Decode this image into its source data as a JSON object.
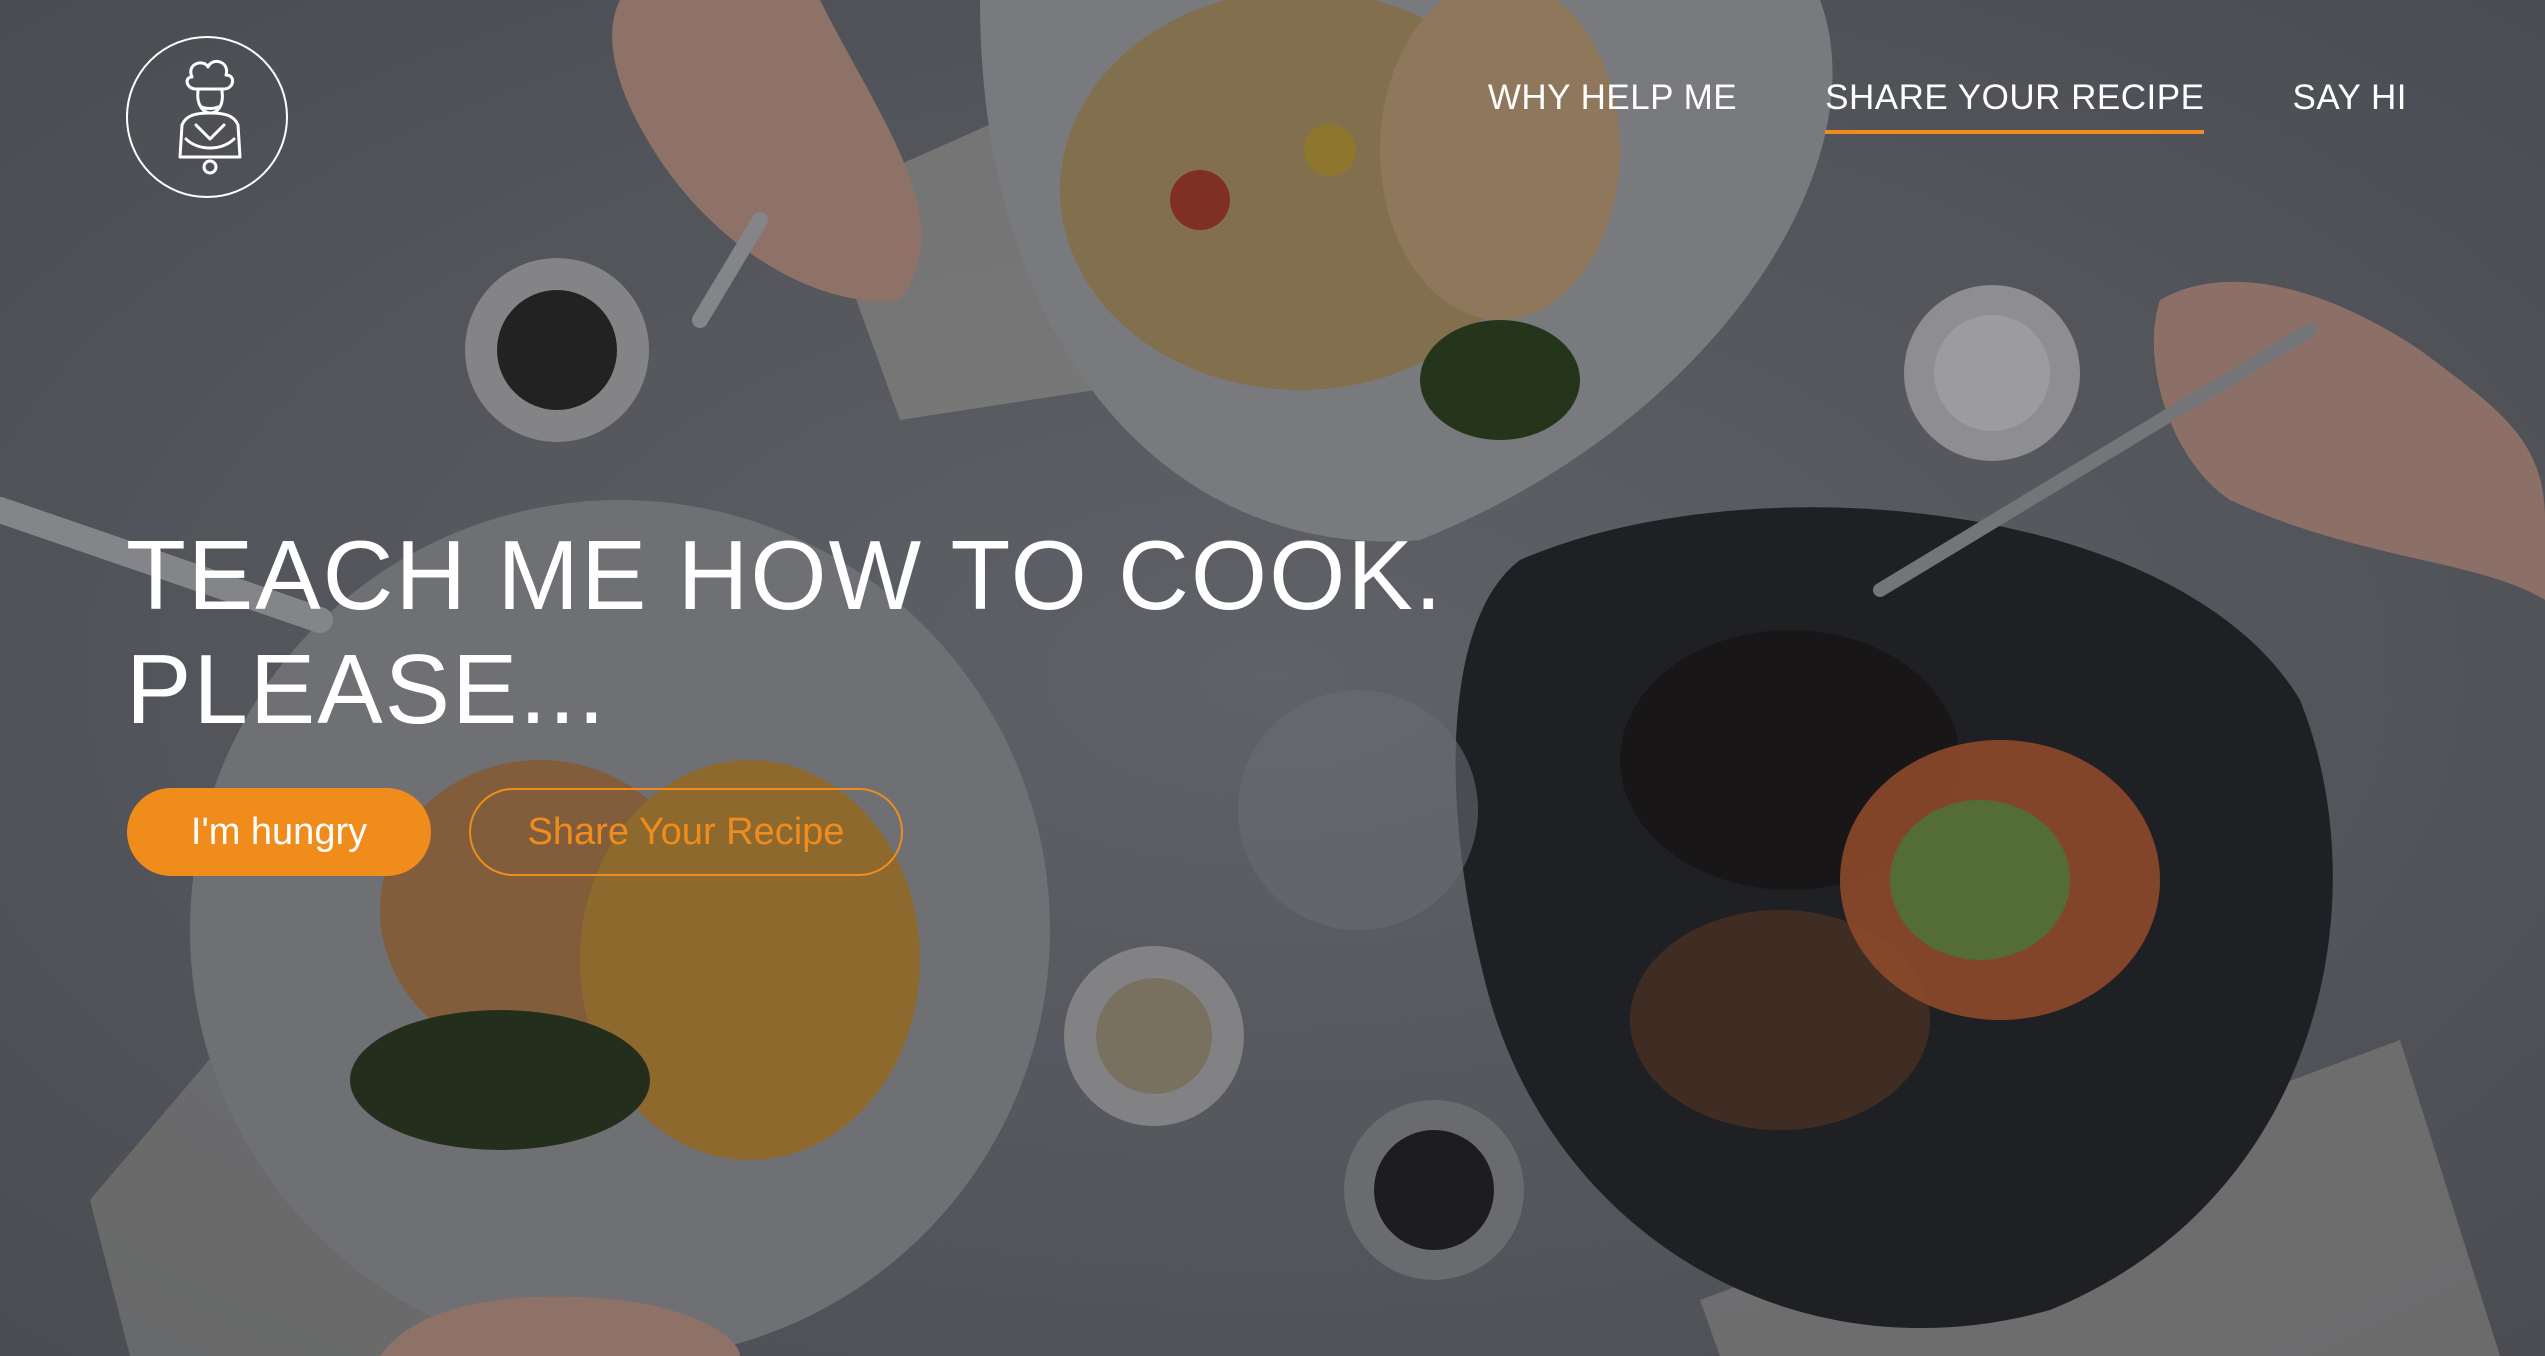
{
  "brand": {
    "logo_icon": "chef-icon"
  },
  "nav": {
    "items": [
      {
        "label": "WHY HELP ME",
        "active": false
      },
      {
        "label": "SHARE YOUR RECIPE",
        "active": true
      },
      {
        "label": "SAY HI",
        "active": false
      }
    ]
  },
  "hero": {
    "title_line1": "TEACH ME HOW TO COOK.",
    "title_line2": "PLEASE...",
    "primary_button": "I'm hungry",
    "secondary_button": "Share Your Recipe"
  },
  "colors": {
    "accent": "#f08c1c",
    "text": "#ffffff",
    "background": "#4a4d53"
  }
}
